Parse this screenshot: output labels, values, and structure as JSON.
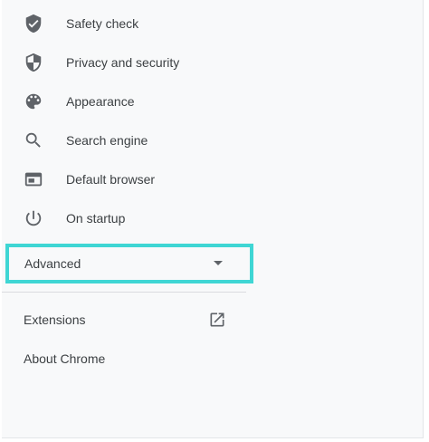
{
  "nav": {
    "items": [
      {
        "label": "Safety check",
        "icon": "shield-check-icon"
      },
      {
        "label": "Privacy and security",
        "icon": "shield-icon"
      },
      {
        "label": "Appearance",
        "icon": "palette-icon"
      },
      {
        "label": "Search engine",
        "icon": "search-icon"
      },
      {
        "label": "Default browser",
        "icon": "browser-window-icon"
      },
      {
        "label": "On startup",
        "icon": "power-icon"
      }
    ]
  },
  "advanced": {
    "label": "Advanced",
    "icon": "arrow-drop-down-icon",
    "highlight_color": "#3fd6d4"
  },
  "footer": {
    "extensions_label": "Extensions",
    "extensions_icon": "open-in-new-icon",
    "about_label": "About Chrome"
  }
}
